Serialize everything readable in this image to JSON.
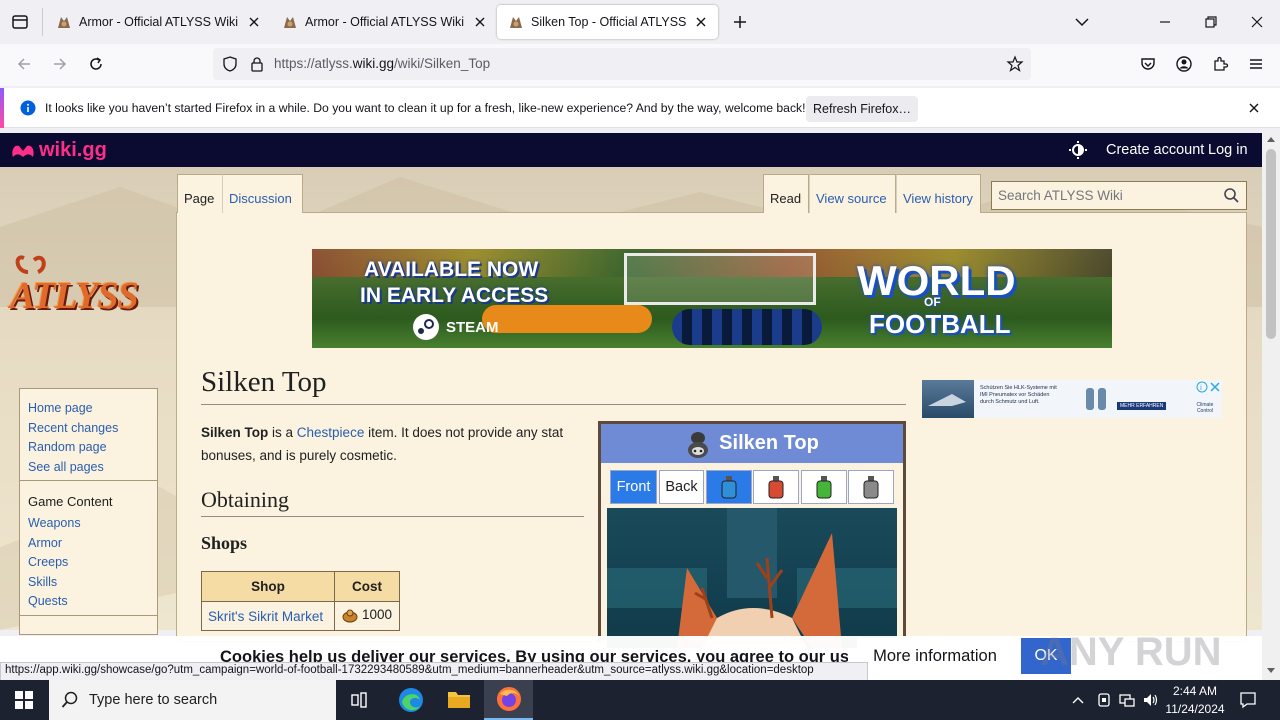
{
  "browser": {
    "tabs": [
      {
        "title": "Armor - Official ATLYSS Wiki",
        "active": false
      },
      {
        "title": "Armor - Official ATLYSS Wiki",
        "active": false
      },
      {
        "title": "Silken Top - Official ATLYSS Wiki",
        "active": true
      }
    ],
    "url_prefix": "https://atlyss.",
    "url_domain": "wiki.gg",
    "url_path": "/wiki/Silken_Top",
    "notification": {
      "message": "It looks like you haven’t started Firefox in a while. Do you want to clean it up for a fresh, like-new experience? And by the way, welcome back!",
      "button": "Refresh Firefox…"
    },
    "status_url": "https://app.wiki.gg/showcase/go?utm_campaign=world-of-football-1732293480589&utm_medium=bannerheader&utm_source=atlyss.wiki.gg&location=desktop"
  },
  "site_header": {
    "logo": "wiki.gg",
    "create_account": "Create account",
    "log_in": "Log in"
  },
  "wiki_tabs": {
    "page": "Page",
    "discussion": "Discussion",
    "read": "Read",
    "view_source": "View source",
    "view_history": "View history"
  },
  "search_placeholder": "Search ATLYSS Wiki",
  "sidebar": {
    "logo_text": "ATLYSS",
    "nav": [
      "Home page",
      "Recent changes",
      "Random page",
      "See all pages"
    ],
    "game_content_heading": "Game Content",
    "game_content": [
      "Weapons",
      "Armor",
      "Creeps",
      "Skills",
      "Quests"
    ]
  },
  "banner": {
    "line1": "AVAILABLE NOW",
    "line2": "IN EARLY ACCESS",
    "platform": "STEAM",
    "game_world": "WORLD",
    "game_of": "OF",
    "game_football": "FOOTBALL"
  },
  "article": {
    "title": "Silken Top",
    "intro_bold": "Silken Top",
    "intro_1": " is a ",
    "intro_link": "Chestpiece",
    "intro_2": " item. It does not provide any stat bonuses, and is purely cosmetic.",
    "h2_obtaining": "Obtaining",
    "h3_shops": "Shops",
    "shops_table": {
      "headers": [
        "Shop",
        "Cost"
      ],
      "rows": [
        {
          "shop": "Skrit's Sikrit Market",
          "cost": "1000"
        }
      ]
    }
  },
  "infobox": {
    "title": "Silken Top",
    "front": "Front",
    "back": "Back",
    "dyes": [
      "#2f8fd8",
      "#d84a32",
      "#45b53a",
      "#8a8a8a"
    ]
  },
  "side_ad": {
    "line1": "Schützen Sie HLK-Systeme mit",
    "line2": "IMI Pneumatex vor Schäden",
    "line3": "durch Schmutz und Luft.",
    "cta": "MEHR ERFAHREN",
    "brand": "Climate Control"
  },
  "cookie": {
    "text": "Cookies help us deliver our services. By using our services, you agree to our use of cookies.",
    "more": "More information",
    "ok": "OK"
  },
  "watermark": "ANY RUN",
  "taskbar": {
    "search_placeholder": "Type here to search",
    "time": "2:44 AM",
    "date": "11/24/2024"
  }
}
